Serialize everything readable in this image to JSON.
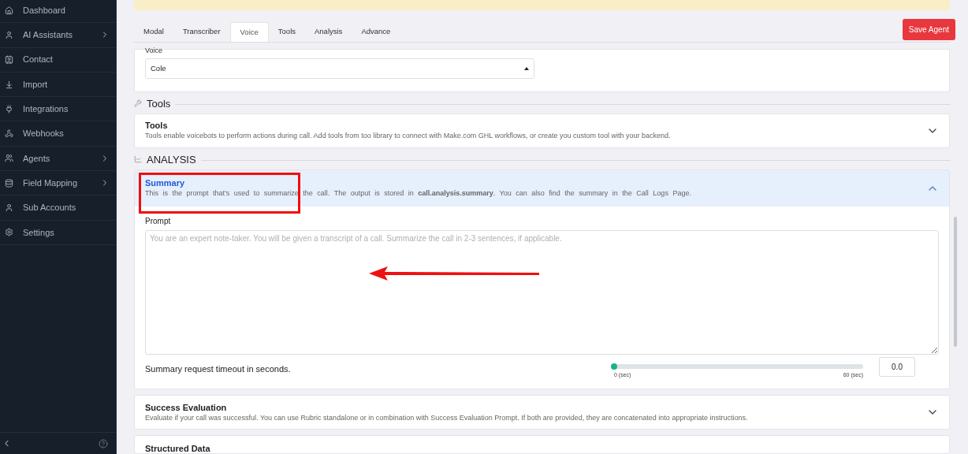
{
  "sidebar": {
    "items": [
      {
        "label": "Dashboard",
        "submenu": false
      },
      {
        "label": "AI Assistants",
        "submenu": true
      },
      {
        "label": "Contact",
        "submenu": false
      },
      {
        "label": "Import",
        "submenu": false
      },
      {
        "label": "Integrations",
        "submenu": false
      },
      {
        "label": "Webhooks",
        "submenu": false
      },
      {
        "label": "Agents",
        "submenu": true
      },
      {
        "label": "Field Mapping",
        "submenu": true
      },
      {
        "label": "Sub Accounts",
        "submenu": false
      },
      {
        "label": "Settings",
        "submenu": false
      }
    ]
  },
  "tabs": [
    {
      "label": "Modal",
      "selected": false
    },
    {
      "label": "Transcriber",
      "selected": false
    },
    {
      "label": "Voice",
      "selected": true
    },
    {
      "label": "Tools",
      "selected": false
    },
    {
      "label": "Analysis",
      "selected": false
    },
    {
      "label": "Advance",
      "selected": false
    }
  ],
  "save_button": "Save Agent",
  "voice": {
    "label": "Voice",
    "value": "Cole"
  },
  "tools_section": {
    "heading": "Tools",
    "cards": [
      {
        "title": "Tools",
        "description": "Tools enable voicebots to perform actions during call. Add tools from too library to connect with Make.com GHL workflows, or create you custom tool with your backend.",
        "expanded": false
      }
    ]
  },
  "analysis_section": {
    "heading": "ANALYSIS",
    "cards": [
      {
        "title": "Summary",
        "description": "This is the prompt that's used to summarize the call. The output is stored in **call.analysis.summary**. You can also find the summary in the Call Logs Page.",
        "expanded": true,
        "prompt_label": "Prompt",
        "prompt_placeholder": "You are an expert note-taker. You will be given a transcript of a call. Summarize the call in 2-3 sentences, if applicable.",
        "timeout_label": "Summary request timeout in seconds.",
        "timeout": {
          "level": 0,
          "min_label": "0 (sec)",
          "max_label": "60 (sec)",
          "value": "0.0"
        }
      },
      {
        "title": "Success Evaluation",
        "description": "Evaluate if your call was successful. You can use Rubric standalone or in combination with Success Evaluation Prompt. If both are provided, they are concatenated into appropriate instructions.",
        "expanded": false
      },
      {
        "title": "Structured Data"
      }
    ]
  }
}
